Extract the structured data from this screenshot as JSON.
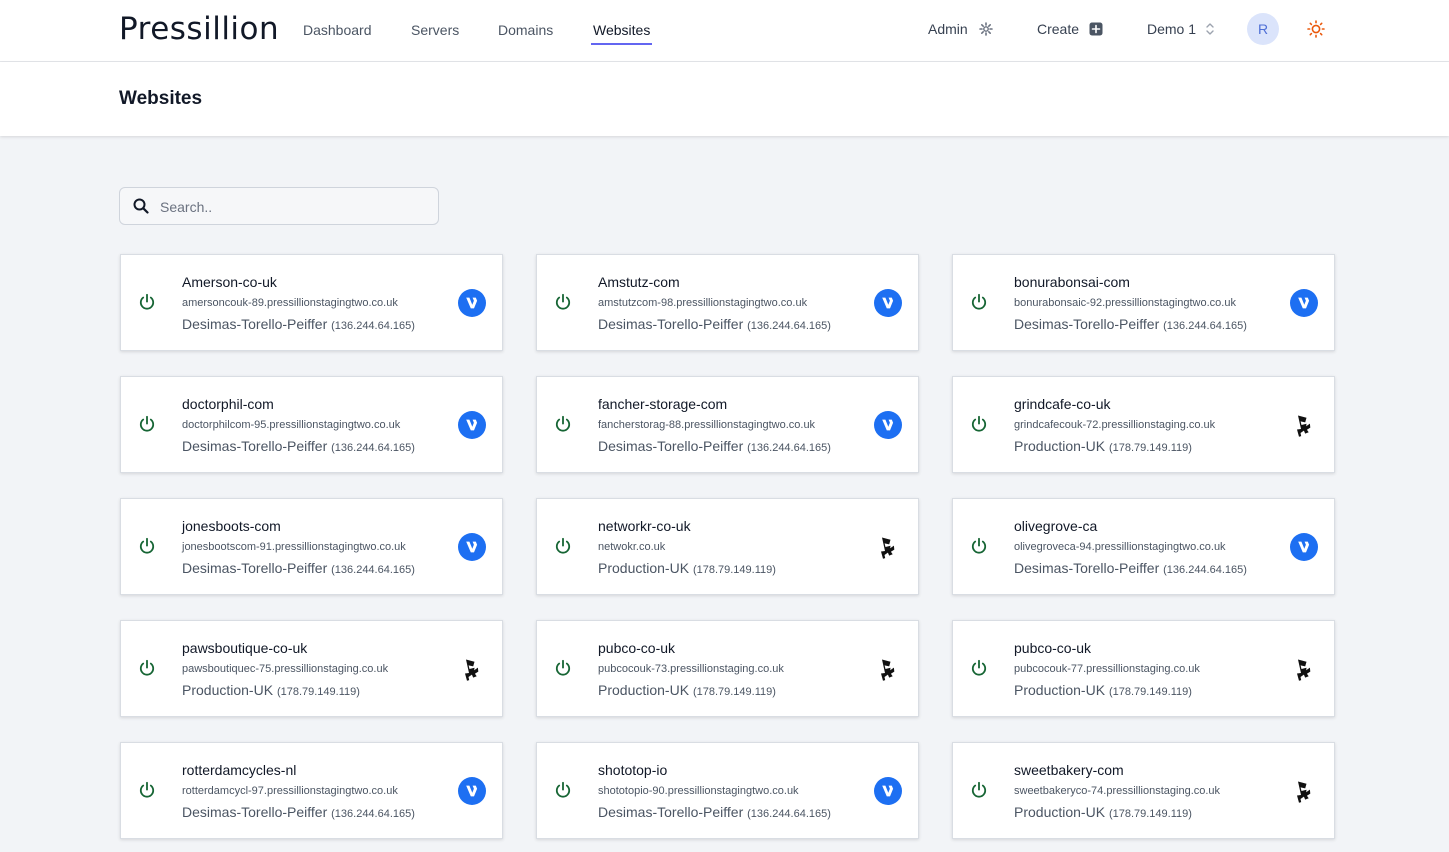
{
  "app": {
    "brand": "Pressillion"
  },
  "nav": {
    "links": [
      "Dashboard",
      "Servers",
      "Domains",
      "Websites"
    ],
    "active": "Websites",
    "admin_label": "Admin",
    "create_label": "Create",
    "team_label": "Demo 1",
    "avatar_initial": "R"
  },
  "page": {
    "title": "Websites"
  },
  "search": {
    "placeholder": "Search..",
    "value": ""
  },
  "colors": {
    "accent": "#6366f1",
    "vultr_blue": "#1d6ff2",
    "power_green": "#166534",
    "sun_orange": "#ea580c"
  },
  "websites": [
    {
      "name": "Amerson-co-uk",
      "url": "amersoncouk-89.pressillionstagingtwo.co.uk",
      "server": "Desimas-Torello-Peiffer",
      "ip": "(136.244.64.165)",
      "provider_icon": "vultr-icon"
    },
    {
      "name": "Amstutz-com",
      "url": "amstutzcom-98.pressillionstagingtwo.co.uk",
      "server": "Desimas-Torello-Peiffer",
      "ip": "(136.244.64.165)",
      "provider_icon": "vultr-icon"
    },
    {
      "name": "bonurabonsai-com",
      "url": "bonurabonsaic-92.pressillionstagingtwo.co.uk",
      "server": "Desimas-Torello-Peiffer",
      "ip": "(136.244.64.165)",
      "provider_icon": "vultr-icon"
    },
    {
      "name": "doctorphil-com",
      "url": "doctorphilcom-95.pressillionstagingtwo.co.uk",
      "server": "Desimas-Torello-Peiffer",
      "ip": "(136.244.64.165)",
      "provider_icon": "vultr-icon"
    },
    {
      "name": "fancher-storage-com",
      "url": "fancherstorag-88.pressillionstagingtwo.co.uk",
      "server": "Desimas-Torello-Peiffer",
      "ip": "(136.244.64.165)",
      "provider_icon": "vultr-icon"
    },
    {
      "name": "grindcafe-co-uk",
      "url": "grindcafecouk-72.pressillionstaging.co.uk",
      "server": "Production-UK",
      "ip": "(178.79.149.119)",
      "provider_icon": "linode-icon"
    },
    {
      "name": "jonesboots-com",
      "url": "jonesbootscom-91.pressillionstagingtwo.co.uk",
      "server": "Desimas-Torello-Peiffer",
      "ip": "(136.244.64.165)",
      "provider_icon": "vultr-icon"
    },
    {
      "name": "networkr-co-uk",
      "url": "netwokr.co.uk",
      "server": "Production-UK",
      "ip": "(178.79.149.119)",
      "provider_icon": "linode-icon"
    },
    {
      "name": "olivegrove-ca",
      "url": "olivegroveca-94.pressillionstagingtwo.co.uk",
      "server": "Desimas-Torello-Peiffer",
      "ip": "(136.244.64.165)",
      "provider_icon": "vultr-icon"
    },
    {
      "name": "pawsboutique-co-uk",
      "url": "pawsboutiquec-75.pressillionstaging.co.uk",
      "server": "Production-UK",
      "ip": "(178.79.149.119)",
      "provider_icon": "linode-icon"
    },
    {
      "name": "pubco-co-uk",
      "url": "pubcocouk-73.pressillionstaging.co.uk",
      "server": "Production-UK",
      "ip": "(178.79.149.119)",
      "provider_icon": "linode-icon"
    },
    {
      "name": "pubco-co-uk",
      "url": "pubcocouk-77.pressillionstaging.co.uk",
      "server": "Production-UK",
      "ip": "(178.79.149.119)",
      "provider_icon": "linode-icon"
    },
    {
      "name": "rotterdamcycles-nl",
      "url": "rotterdamcycl-97.pressillionstagingtwo.co.uk",
      "server": "Desimas-Torello-Peiffer",
      "ip": "(136.244.64.165)",
      "provider_icon": "vultr-icon"
    },
    {
      "name": "shototop-io",
      "url": "shototopio-90.pressillionstagingtwo.co.uk",
      "server": "Desimas-Torello-Peiffer",
      "ip": "(136.244.64.165)",
      "provider_icon": "vultr-icon"
    },
    {
      "name": "sweetbakery-com",
      "url": "sweetbakeryco-74.pressillionstaging.co.uk",
      "server": "Production-UK",
      "ip": "(178.79.149.119)",
      "provider_icon": "linode-icon"
    }
  ]
}
